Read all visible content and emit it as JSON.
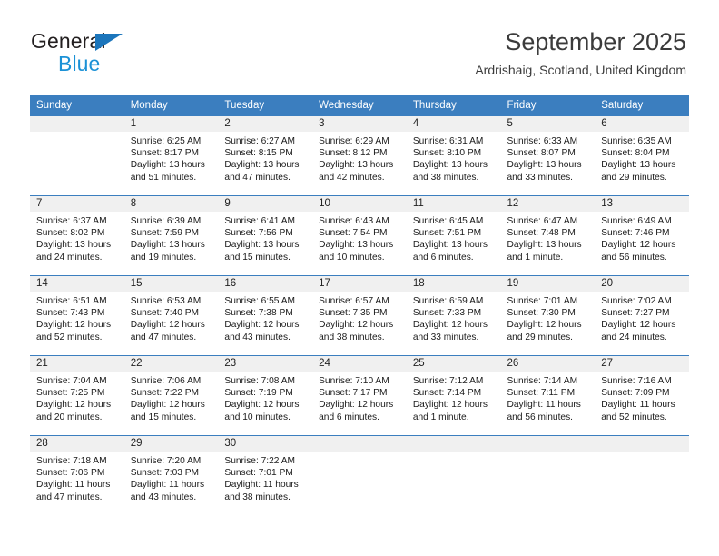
{
  "brand": {
    "name_top": "General",
    "name_bottom": "Blue",
    "triangle_color": "#1b75bb",
    "blue_text_color": "#1b91d6"
  },
  "header": {
    "title": "September 2025",
    "subtitle": "Ardrishaig, Scotland, United Kingdom"
  },
  "theme": {
    "header_row_bg": "#3b7ebf",
    "daynum_band_bg": "#f0f0f0",
    "grid_line": "#3b7ebf",
    "text": "#1a1a1a"
  },
  "calendar": {
    "weekday_headers": [
      "Sunday",
      "Monday",
      "Tuesday",
      "Wednesday",
      "Thursday",
      "Friday",
      "Saturday"
    ],
    "weeks": [
      [
        {
          "day": "",
          "sunrise": "",
          "sunset": "",
          "daylight_line1": "",
          "daylight_line2": ""
        },
        {
          "day": "1",
          "sunrise": "Sunrise: 6:25 AM",
          "sunset": "Sunset: 8:17 PM",
          "daylight_line1": "Daylight: 13 hours",
          "daylight_line2": "and 51 minutes."
        },
        {
          "day": "2",
          "sunrise": "Sunrise: 6:27 AM",
          "sunset": "Sunset: 8:15 PM",
          "daylight_line1": "Daylight: 13 hours",
          "daylight_line2": "and 47 minutes."
        },
        {
          "day": "3",
          "sunrise": "Sunrise: 6:29 AM",
          "sunset": "Sunset: 8:12 PM",
          "daylight_line1": "Daylight: 13 hours",
          "daylight_line2": "and 42 minutes."
        },
        {
          "day": "4",
          "sunrise": "Sunrise: 6:31 AM",
          "sunset": "Sunset: 8:10 PM",
          "daylight_line1": "Daylight: 13 hours",
          "daylight_line2": "and 38 minutes."
        },
        {
          "day": "5",
          "sunrise": "Sunrise: 6:33 AM",
          "sunset": "Sunset: 8:07 PM",
          "daylight_line1": "Daylight: 13 hours",
          "daylight_line2": "and 33 minutes."
        },
        {
          "day": "6",
          "sunrise": "Sunrise: 6:35 AM",
          "sunset": "Sunset: 8:04 PM",
          "daylight_line1": "Daylight: 13 hours",
          "daylight_line2": "and 29 minutes."
        }
      ],
      [
        {
          "day": "7",
          "sunrise": "Sunrise: 6:37 AM",
          "sunset": "Sunset: 8:02 PM",
          "daylight_line1": "Daylight: 13 hours",
          "daylight_line2": "and 24 minutes."
        },
        {
          "day": "8",
          "sunrise": "Sunrise: 6:39 AM",
          "sunset": "Sunset: 7:59 PM",
          "daylight_line1": "Daylight: 13 hours",
          "daylight_line2": "and 19 minutes."
        },
        {
          "day": "9",
          "sunrise": "Sunrise: 6:41 AM",
          "sunset": "Sunset: 7:56 PM",
          "daylight_line1": "Daylight: 13 hours",
          "daylight_line2": "and 15 minutes."
        },
        {
          "day": "10",
          "sunrise": "Sunrise: 6:43 AM",
          "sunset": "Sunset: 7:54 PM",
          "daylight_line1": "Daylight: 13 hours",
          "daylight_line2": "and 10 minutes."
        },
        {
          "day": "11",
          "sunrise": "Sunrise: 6:45 AM",
          "sunset": "Sunset: 7:51 PM",
          "daylight_line1": "Daylight: 13 hours",
          "daylight_line2": "and 6 minutes."
        },
        {
          "day": "12",
          "sunrise": "Sunrise: 6:47 AM",
          "sunset": "Sunset: 7:48 PM",
          "daylight_line1": "Daylight: 13 hours",
          "daylight_line2": "and 1 minute."
        },
        {
          "day": "13",
          "sunrise": "Sunrise: 6:49 AM",
          "sunset": "Sunset: 7:46 PM",
          "daylight_line1": "Daylight: 12 hours",
          "daylight_line2": "and 56 minutes."
        }
      ],
      [
        {
          "day": "14",
          "sunrise": "Sunrise: 6:51 AM",
          "sunset": "Sunset: 7:43 PM",
          "daylight_line1": "Daylight: 12 hours",
          "daylight_line2": "and 52 minutes."
        },
        {
          "day": "15",
          "sunrise": "Sunrise: 6:53 AM",
          "sunset": "Sunset: 7:40 PM",
          "daylight_line1": "Daylight: 12 hours",
          "daylight_line2": "and 47 minutes."
        },
        {
          "day": "16",
          "sunrise": "Sunrise: 6:55 AM",
          "sunset": "Sunset: 7:38 PM",
          "daylight_line1": "Daylight: 12 hours",
          "daylight_line2": "and 43 minutes."
        },
        {
          "day": "17",
          "sunrise": "Sunrise: 6:57 AM",
          "sunset": "Sunset: 7:35 PM",
          "daylight_line1": "Daylight: 12 hours",
          "daylight_line2": "and 38 minutes."
        },
        {
          "day": "18",
          "sunrise": "Sunrise: 6:59 AM",
          "sunset": "Sunset: 7:33 PM",
          "daylight_line1": "Daylight: 12 hours",
          "daylight_line2": "and 33 minutes."
        },
        {
          "day": "19",
          "sunrise": "Sunrise: 7:01 AM",
          "sunset": "Sunset: 7:30 PM",
          "daylight_line1": "Daylight: 12 hours",
          "daylight_line2": "and 29 minutes."
        },
        {
          "day": "20",
          "sunrise": "Sunrise: 7:02 AM",
          "sunset": "Sunset: 7:27 PM",
          "daylight_line1": "Daylight: 12 hours",
          "daylight_line2": "and 24 minutes."
        }
      ],
      [
        {
          "day": "21",
          "sunrise": "Sunrise: 7:04 AM",
          "sunset": "Sunset: 7:25 PM",
          "daylight_line1": "Daylight: 12 hours",
          "daylight_line2": "and 20 minutes."
        },
        {
          "day": "22",
          "sunrise": "Sunrise: 7:06 AM",
          "sunset": "Sunset: 7:22 PM",
          "daylight_line1": "Daylight: 12 hours",
          "daylight_line2": "and 15 minutes."
        },
        {
          "day": "23",
          "sunrise": "Sunrise: 7:08 AM",
          "sunset": "Sunset: 7:19 PM",
          "daylight_line1": "Daylight: 12 hours",
          "daylight_line2": "and 10 minutes."
        },
        {
          "day": "24",
          "sunrise": "Sunrise: 7:10 AM",
          "sunset": "Sunset: 7:17 PM",
          "daylight_line1": "Daylight: 12 hours",
          "daylight_line2": "and 6 minutes."
        },
        {
          "day": "25",
          "sunrise": "Sunrise: 7:12 AM",
          "sunset": "Sunset: 7:14 PM",
          "daylight_line1": "Daylight: 12 hours",
          "daylight_line2": "and 1 minute."
        },
        {
          "day": "26",
          "sunrise": "Sunrise: 7:14 AM",
          "sunset": "Sunset: 7:11 PM",
          "daylight_line1": "Daylight: 11 hours",
          "daylight_line2": "and 56 minutes."
        },
        {
          "day": "27",
          "sunrise": "Sunrise: 7:16 AM",
          "sunset": "Sunset: 7:09 PM",
          "daylight_line1": "Daylight: 11 hours",
          "daylight_line2": "and 52 minutes."
        }
      ],
      [
        {
          "day": "28",
          "sunrise": "Sunrise: 7:18 AM",
          "sunset": "Sunset: 7:06 PM",
          "daylight_line1": "Daylight: 11 hours",
          "daylight_line2": "and 47 minutes."
        },
        {
          "day": "29",
          "sunrise": "Sunrise: 7:20 AM",
          "sunset": "Sunset: 7:03 PM",
          "daylight_line1": "Daylight: 11 hours",
          "daylight_line2": "and 43 minutes."
        },
        {
          "day": "30",
          "sunrise": "Sunrise: 7:22 AM",
          "sunset": "Sunset: 7:01 PM",
          "daylight_line1": "Daylight: 11 hours",
          "daylight_line2": "and 38 minutes."
        },
        {
          "day": "",
          "sunrise": "",
          "sunset": "",
          "daylight_line1": "",
          "daylight_line2": ""
        },
        {
          "day": "",
          "sunrise": "",
          "sunset": "",
          "daylight_line1": "",
          "daylight_line2": ""
        },
        {
          "day": "",
          "sunrise": "",
          "sunset": "",
          "daylight_line1": "",
          "daylight_line2": ""
        },
        {
          "day": "",
          "sunrise": "",
          "sunset": "",
          "daylight_line1": "",
          "daylight_line2": ""
        }
      ]
    ]
  }
}
